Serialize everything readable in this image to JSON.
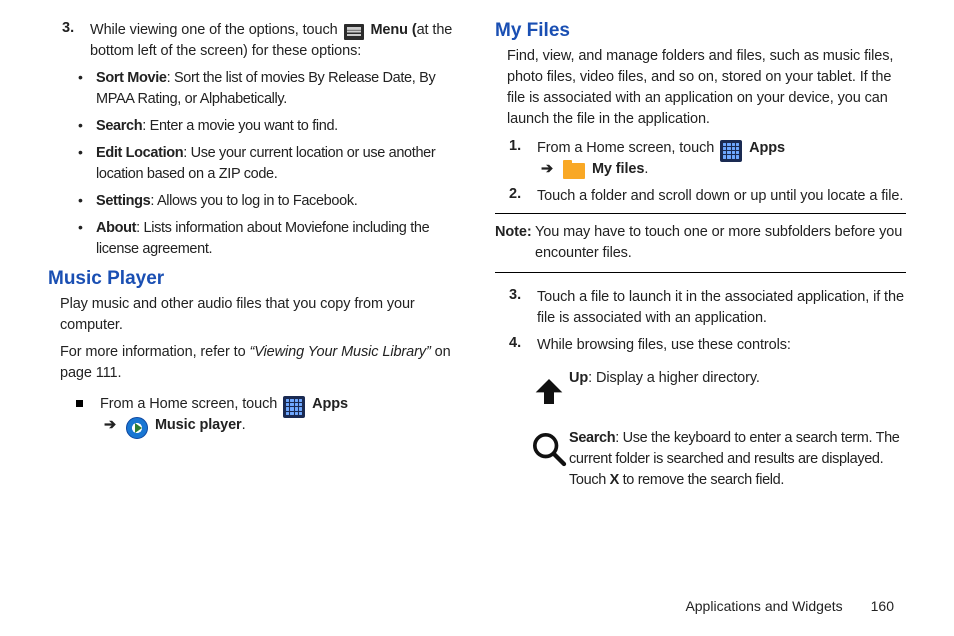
{
  "left": {
    "step3": {
      "num": "3.",
      "pre": "While viewing one of the options, touch ",
      "post_bold": "Menu (",
      "tail": "at the bottom left of the screen) for these options:"
    },
    "opts": [
      {
        "b": "Sort Movie",
        "t": ": Sort the list of movies By Release Date, By MPAA Rating, or Alphabetically."
      },
      {
        "b": "Search",
        "t": ": Enter a movie you want to find."
      },
      {
        "b": "Edit Location",
        "t": ": Use your current location or use another location based on a ZIP code."
      },
      {
        "b": "Settings",
        "t": ": Allows you to log in to Facebook."
      },
      {
        "b": "About",
        "t": ": Lists information about Moviefone including the license agreement."
      }
    ],
    "music_head": "Music Player",
    "music_p1": "Play music and other audio files that you copy from your computer.",
    "music_p2_pre": "For more information, refer to ",
    "music_p2_ref": "“Viewing Your Music Library”",
    "music_p2_post": " on page 111.",
    "music_step_pre": "From a Home screen, touch ",
    "apps_label": "Apps",
    "arrow": "➔",
    "music_label": "Music player"
  },
  "right": {
    "head": "My Files",
    "intro": "Find, view, and manage folders and files, such as music files, photo files, video files, and so on, stored on your tablet. If the file is associated with an application on your device, you can launch the file in the application.",
    "s1": {
      "num": "1.",
      "pre": "From a Home screen, touch ",
      "apps": "Apps",
      "arrow": "➔",
      "files": "My files",
      "dot": "."
    },
    "s2": {
      "num": "2.",
      "text": "Touch a folder and scroll down or up until you locate a file."
    },
    "note_label": "Note:",
    "note_text": "You may have to touch one or more subfolders before you encounter files.",
    "s3": {
      "num": "3.",
      "text": "Touch a file to launch it in the associated application, if the file is associated with an application."
    },
    "s4": {
      "num": "4.",
      "text": "While browsing files, use these controls:"
    },
    "ctrl_up": {
      "b": "Up",
      "t": ": Display a higher directory."
    },
    "ctrl_search": {
      "b": "Search",
      "t1": ": Use the keyboard to enter a search term. The current folder is searched and results are displayed. Touch ",
      "x": "X",
      "t2": " to remove the search field."
    }
  },
  "footer": {
    "section": "Applications and Widgets",
    "page": "160"
  }
}
